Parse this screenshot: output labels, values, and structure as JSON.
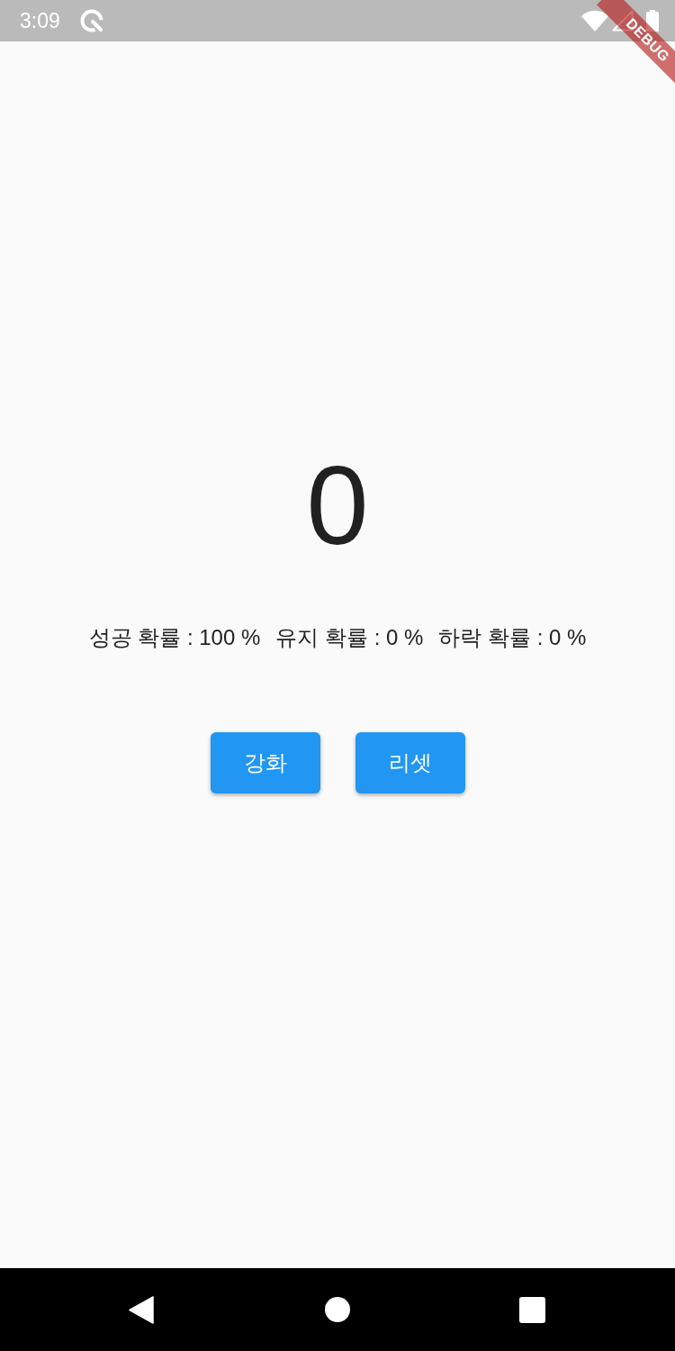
{
  "status_bar": {
    "time": "3:09"
  },
  "debug_banner": {
    "label": "DEBUG"
  },
  "counter": {
    "value": "0"
  },
  "probabilities": [
    "성공 확률 : 100 %",
    "유지 확률 : 0 %",
    "하락 확률 : 0 %"
  ],
  "buttons": [
    {
      "label": "강화"
    },
    {
      "label": "리셋"
    }
  ]
}
